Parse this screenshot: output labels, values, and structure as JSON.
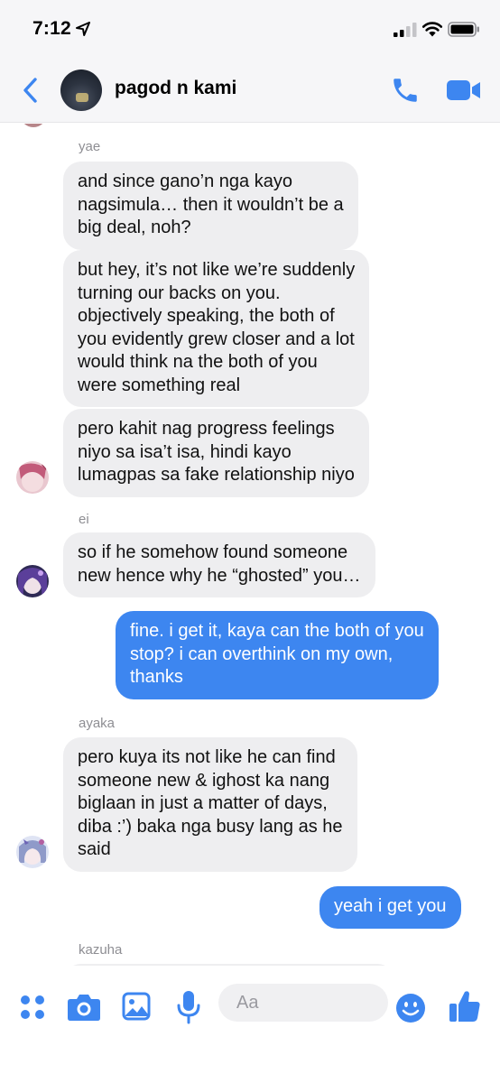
{
  "status_bar": {
    "time": "7:12"
  },
  "header": {
    "chat_name": "pagod n kami"
  },
  "messages": [
    {
      "type": "name",
      "text": "yae"
    },
    {
      "type": "incoming",
      "lines": [
        "and since gano’n nga kayo",
        "nagsimula… then it wouldn’t be a",
        "big deal, noh?"
      ]
    },
    {
      "type": "incoming",
      "lines": [
        "but hey, it’s not like we’re suddenly",
        "turning our backs on you.",
        "objectively speaking, the both of",
        "you evidently grew closer and a lot",
        "would think na the both of you",
        "were something real"
      ]
    },
    {
      "type": "incoming",
      "lines": [
        "pero kahit nag progress feelings",
        "niyo sa isa’t isa, hindi kayo",
        "lumagpas sa fake relationship niyo"
      ]
    },
    {
      "type": "name",
      "text": "ei"
    },
    {
      "type": "incoming",
      "lines": [
        "so if he somehow found someone",
        "new hence why he “ghosted” you…"
      ]
    },
    {
      "type": "outgoing",
      "lines": [
        "fine. i get it, kaya can the both of you",
        "stop? i can overthink on my own,",
        "thanks"
      ]
    },
    {
      "type": "name",
      "text": "ayaka"
    },
    {
      "type": "incoming",
      "lines": [
        "pero kuya its not like he can find",
        "someone new & ighost ka nang",
        "biglaan in just a matter of days,",
        "diba :’) baka nga busy lang as he",
        "said"
      ]
    },
    {
      "type": "outgoing",
      "lines": [
        "yeah i get you"
      ]
    },
    {
      "type": "name",
      "text": "kazuha"
    }
  ],
  "composer": {
    "placeholder": "Aa"
  },
  "colors": {
    "accent": "#3d86f0",
    "incoming_bubble": "#eeeef0",
    "meta_text": "#8e8e93"
  },
  "icons": [
    "location-arrow-icon",
    "signal-icon",
    "wifi-icon",
    "battery-icon",
    "back-icon",
    "phone-icon",
    "video-icon",
    "apps-grid-icon",
    "camera-icon",
    "image-icon",
    "microphone-icon",
    "emoji-icon",
    "thumbs-up-icon"
  ]
}
